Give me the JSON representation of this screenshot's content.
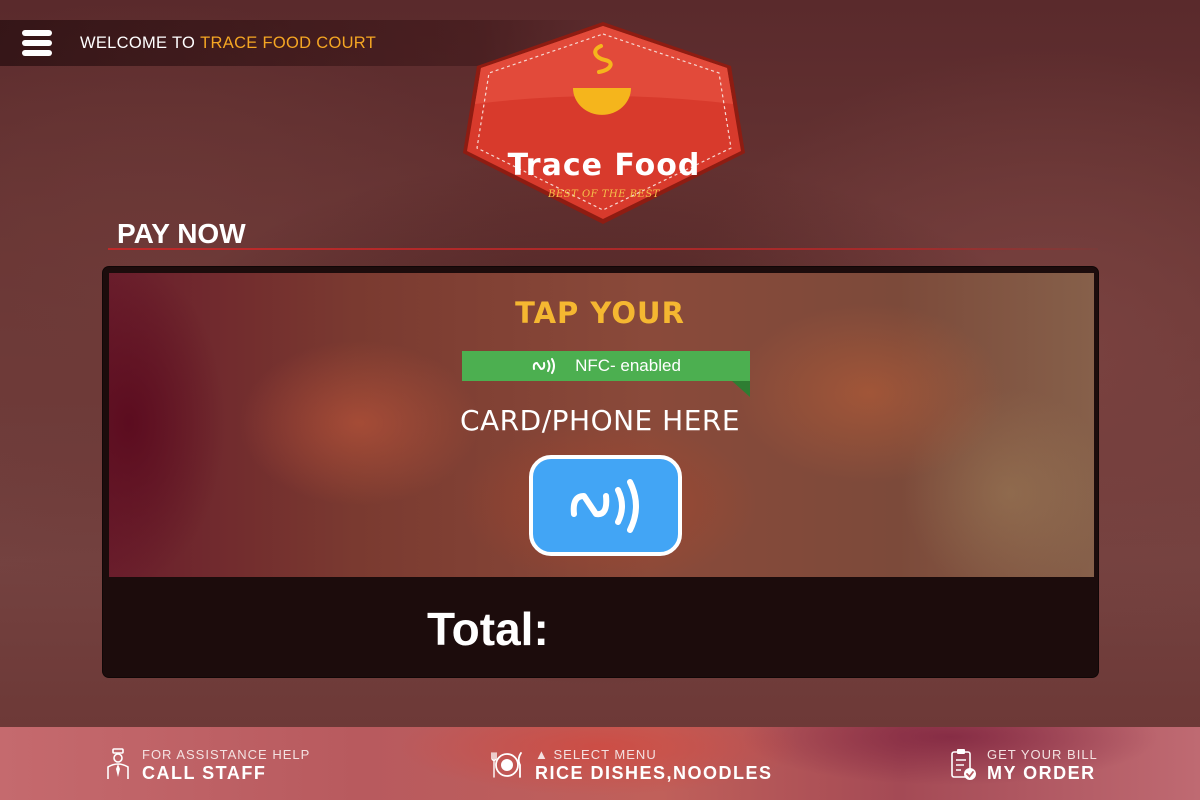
{
  "header": {
    "welcome_prefix": "WELCOME TO",
    "venue_name": "TRACE FOOD COURT"
  },
  "logo": {
    "title": "Trace Food",
    "tagline": "BEST OF THE BEST"
  },
  "payment": {
    "heading": "PAY NOW",
    "instruction_top": "TAP YOUR",
    "nfc_badge": "NFC- enabled",
    "instruction_bottom": "CARD/PHONE HERE",
    "total_label": "Total:"
  },
  "footer": {
    "assistance": {
      "caption": "FOR ASSISTANCE HELP",
      "label": "CALL STAFF",
      "icon": "waiter-icon"
    },
    "menu": {
      "caption": "▲ SELECT MENU",
      "label": "RICE DISHES,NOODLES",
      "icon": "plate-cutlery-icon"
    },
    "bill": {
      "caption": "GET YOUR BILL",
      "label": "MY ORDER",
      "icon": "clipboard-check-icon"
    }
  },
  "colors": {
    "accent_orange": "#f5a623",
    "badge_red": "#d63a2a",
    "nfc_green": "#4caf50",
    "nfc_blue": "#42a5f5"
  }
}
